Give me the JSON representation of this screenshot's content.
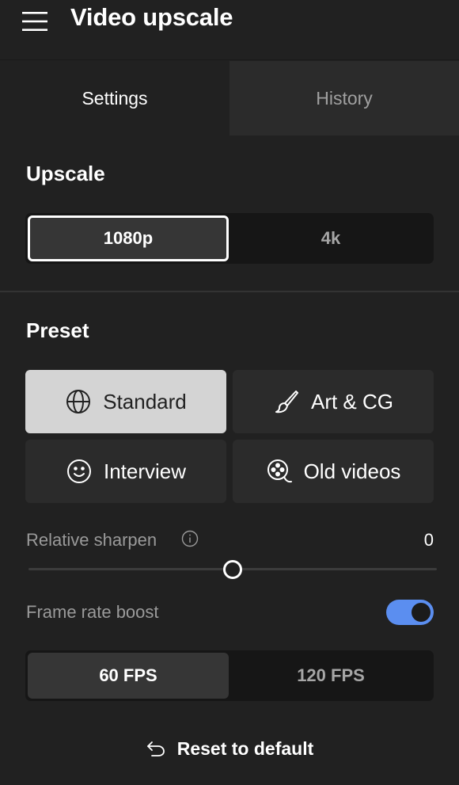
{
  "header": {
    "title": "Video upscale",
    "menu_icon": "hamburger-menu-icon"
  },
  "tabs": [
    {
      "label": "Settings",
      "active": true
    },
    {
      "label": "History",
      "active": false
    }
  ],
  "upscale": {
    "title": "Upscale",
    "options": [
      {
        "label": "1080p",
        "selected": true
      },
      {
        "label": "4k",
        "selected": false
      }
    ]
  },
  "preset": {
    "title": "Preset",
    "options": [
      {
        "label": "Standard",
        "icon": "globe-icon",
        "selected": true
      },
      {
        "label": "Art & CG",
        "icon": "paintbrush-icon",
        "selected": false
      },
      {
        "label": "Interview",
        "icon": "smiley-face-icon",
        "selected": false
      },
      {
        "label": "Old videos",
        "icon": "film-reel-icon",
        "selected": false
      }
    ]
  },
  "sharpen": {
    "label": "Relative sharpen",
    "value": "0",
    "level_fraction": 0.5,
    "info_icon": "info-icon"
  },
  "frame_rate": {
    "label": "Frame rate boost",
    "enabled": true,
    "options": [
      {
        "label": "60 FPS",
        "selected": true
      },
      {
        "label": "120 FPS",
        "selected": false
      }
    ]
  },
  "reset": {
    "label": "Reset to default",
    "icon": "undo-arrow-icon"
  },
  "colors": {
    "background": "#212121",
    "toggle_on": "#5b8ef0",
    "selected_preset": "#d4d4d4"
  }
}
